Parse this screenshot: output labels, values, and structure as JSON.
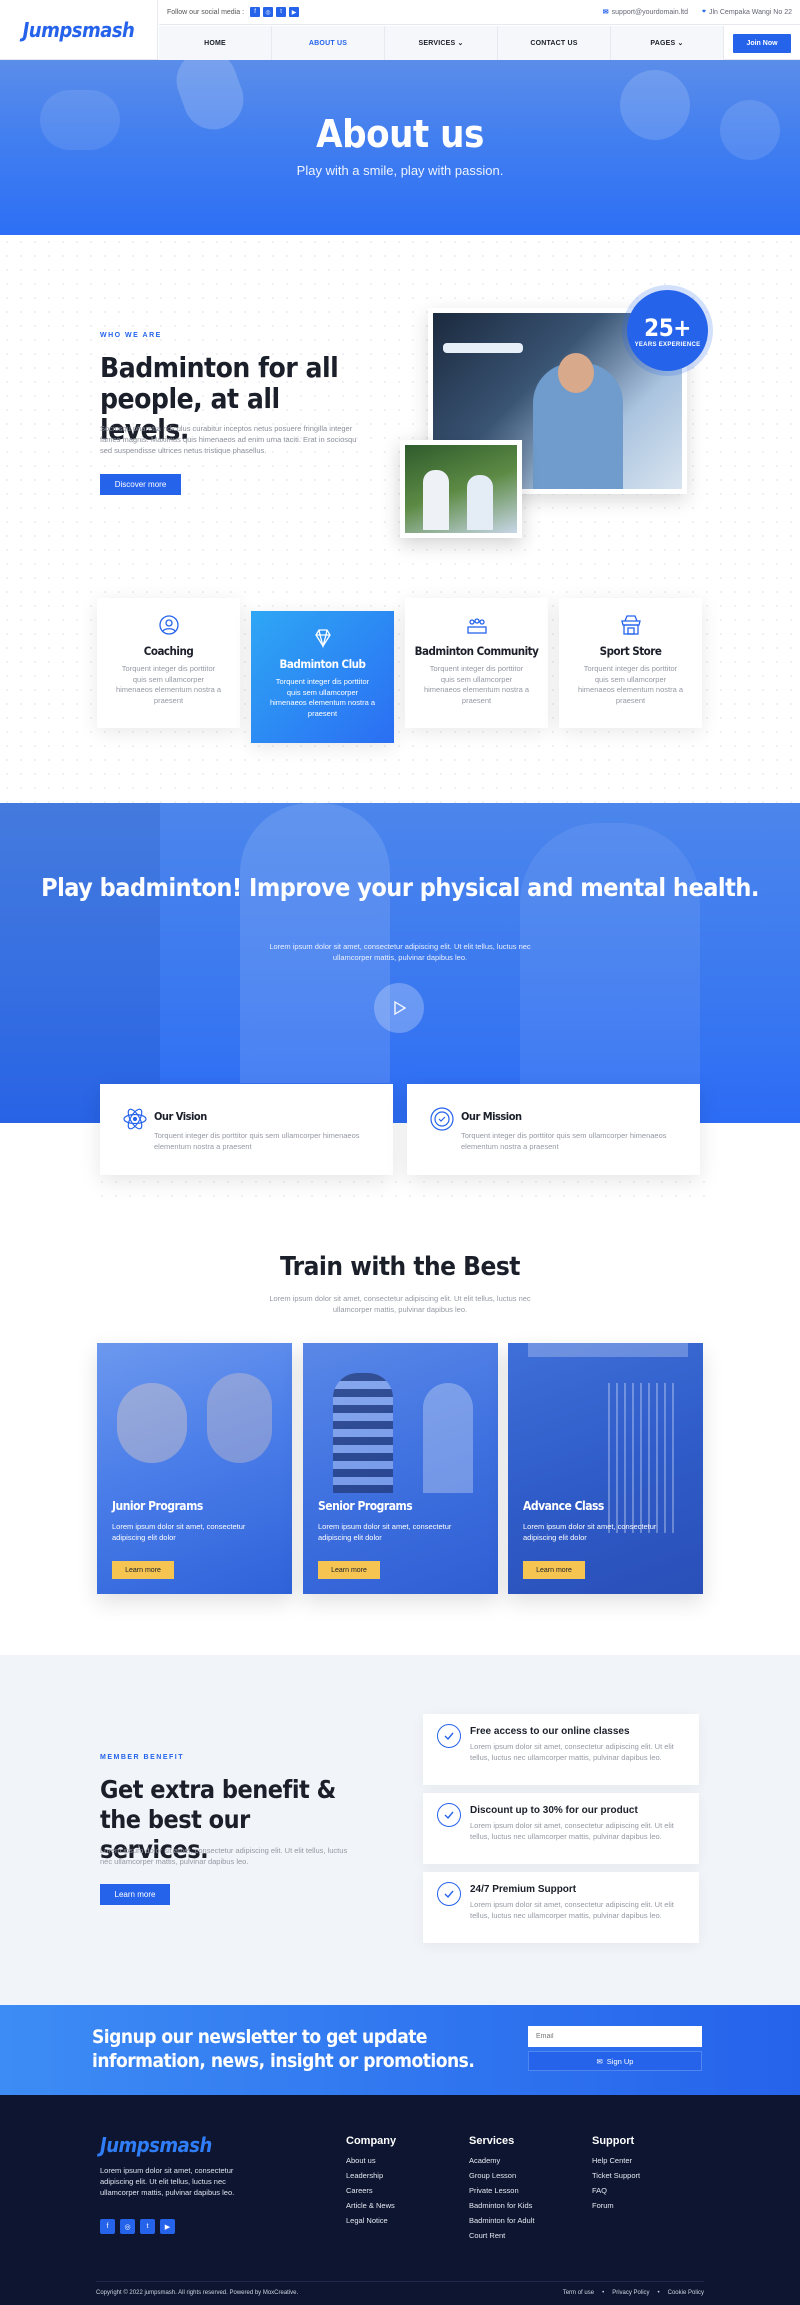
{
  "header": {
    "logo": "Jumpsmash",
    "follow_label": "Follow our social media :",
    "email": "support@yourdomain.ltd",
    "address": "Jln Cempaka Wangi No 22",
    "nav": [
      "HOME",
      "ABOUT US",
      "SERVICES",
      "CONTACT US",
      "PAGES"
    ],
    "join": "Join Now"
  },
  "hero": {
    "title": "About us",
    "subtitle": "Play with a smile, play with passion."
  },
  "about": {
    "label": "WHO WE ARE",
    "title": "Badminton for all people, at all levels.",
    "text": "Sociosqu pharetra ridiculus curabitur inceptos netus posuere fringilla integer fames magnis. Maximus quis himenaeos ad enim urna taciti. Erat in sociosqu sed suspendisse ultrices netus tristique phasellus.",
    "button": "Discover more",
    "badge_num": "25+",
    "badge_label": "YEARS EXPERIENCE"
  },
  "features": [
    {
      "title": "Coaching",
      "text": "Torquent integer dis porttitor quis sem ullamcorper himenaeos elementum nostra a praesent"
    },
    {
      "title": "Badminton Club",
      "text": "Torquent integer dis porttitor quis sem ullamcorper himenaeos elementum nostra a praesent"
    },
    {
      "title": "Badminton Community",
      "text": "Torquent integer dis porttitor quis sem ullamcorper himenaeos elementum nostra a praesent"
    },
    {
      "title": "Sport Store",
      "text": "Torquent integer dis porttitor quis sem ullamcorper himenaeos elementum nostra a praesent"
    }
  ],
  "video": {
    "title": "Play badminton! Improve your physical and mental health.",
    "text": "Lorem ipsum dolor sit amet, consectetur adipiscing elit. Ut elit tellus, luctus nec ullamcorper mattis, pulvinar dapibus leo."
  },
  "vision": {
    "title": "Our Vision",
    "text": "Torquent integer dis porttitor quis sem ullamcorper himenaeos elementum nostra a praesent"
  },
  "mission": {
    "title": "Our Mission",
    "text": "Torquent integer dis porttitor quis sem ullamcorper himenaeos elementum nostra a praesent"
  },
  "train": {
    "title": "Train with the Best",
    "text": "Lorem ipsum dolor sit amet, consectetur adipiscing elit. Ut elit tellus, luctus nec ullamcorper mattis, pulvinar dapibus leo.",
    "cards": [
      {
        "title": "Junior Programs",
        "text": "Lorem ipsum dolor sit amet, consectetur adipiscing elit dolor",
        "button": "Learn more"
      },
      {
        "title": "Senior Programs",
        "text": "Lorem ipsum dolor sit amet, consectetur adipiscing elit dolor",
        "button": "Learn more"
      },
      {
        "title": "Advance Class",
        "text": "Lorem ipsum dolor sit amet, consectetur adipiscing elit dolor",
        "button": "Learn more"
      }
    ]
  },
  "member": {
    "label": "MEMBER BENEFIT",
    "title": "Get extra benefit & the best our services.",
    "text": "Lorem ipsum dolor sit amet, consectetur adipiscing elit. Ut elit tellus, luctus nec ullamcorper mattis, pulvinar dapibus leo.",
    "button": "Learn more",
    "benefits": [
      {
        "title": "Free access to our online classes",
        "text": "Lorem ipsum dolor sit amet, consectetur adipiscing elit. Ut elit tellus, luctus nec ullamcorper mattis, pulvinar dapibus leo."
      },
      {
        "title": "Discount up to 30% for our product",
        "text": "Lorem ipsum dolor sit amet, consectetur adipiscing elit. Ut elit tellus, luctus nec ullamcorper mattis, pulvinar dapibus leo."
      },
      {
        "title": "24/7 Premium Support",
        "text": "Lorem ipsum dolor sit amet, consectetur adipiscing elit. Ut elit tellus, luctus nec ullamcorper mattis, pulvinar dapibus leo."
      }
    ]
  },
  "newsletter": {
    "title": "Signup our newsletter to get update information, news, insight or promotions.",
    "placeholder": "Email",
    "button": "Sign Up"
  },
  "footer": {
    "logo": "Jumpsmash",
    "desc": "Lorem ipsum dolor sit amet, consectetur adipiscing elit. Ut elit tellus, luctus nec ullamcorper mattis, pulvinar dapibus leo.",
    "company": {
      "title": "Company",
      "links": [
        "About us",
        "Leadership",
        "Careers",
        "Article & News",
        "Legal Notice"
      ]
    },
    "services": {
      "title": "Services",
      "links": [
        "Academy",
        "Group Lesson",
        "Private Lesson",
        "Badminton for Kids",
        "Badminton for Adult",
        "Court Rent"
      ]
    },
    "support": {
      "title": "Support",
      "links": [
        "Help Center",
        "Ticket Support",
        "FAQ",
        "Forum"
      ]
    },
    "copyright": "Copyright © 2022 jumpsmash. All rights reserved. Powered by MoxCreative.",
    "legal": [
      "Term of use",
      "Privacy Policy",
      "Cookie Policy"
    ]
  },
  "colors": {
    "primary": "#2563eb",
    "accent": "#f5c451",
    "footer": "#0d1530"
  }
}
